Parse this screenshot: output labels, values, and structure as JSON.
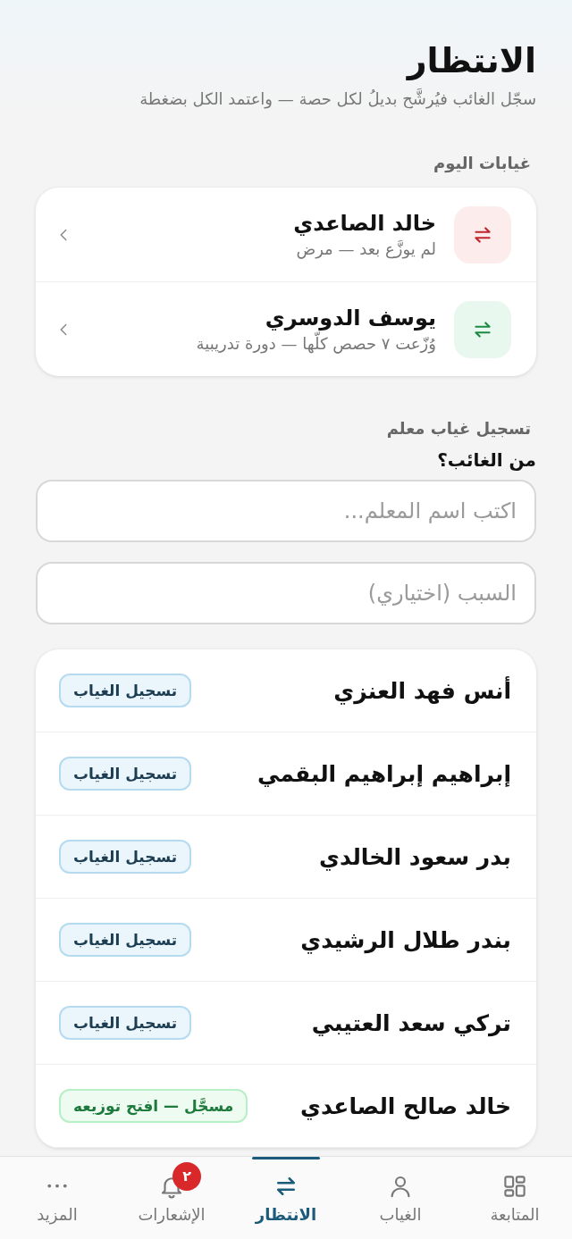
{
  "header": {
    "title": "الانتظار",
    "subtitle": "سجّل الغائب فيُرشَّح بديلُ لكل حصة — واعتمد الكل بضغطة"
  },
  "today_absences": {
    "label": "غيابات اليوم",
    "items": [
      {
        "name": "خالد الصاعدي",
        "detail": "لم يوزَّع بعد — مرض",
        "kind": "pending"
      },
      {
        "name": "يوسف الدوسري",
        "detail": "وُزّعت ٧ حصص كلّها — دورة تدريبية",
        "kind": "done"
      }
    ]
  },
  "register_absence": {
    "label": "تسجيل غياب معلم",
    "question": "من الغائب؟",
    "name_field": {
      "placeholder": "اكتب اسم المعلم..."
    },
    "reason_field": {
      "placeholder": "السبب (اختياري)"
    }
  },
  "teachers": [
    {
      "name": "أنس فهد العنزي",
      "action": "تسجيل الغياب",
      "kind": "register"
    },
    {
      "name": "إبراهيم إبراهيم البقمي",
      "action": "تسجيل الغياب",
      "kind": "register"
    },
    {
      "name": "بدر سعود الخالدي",
      "action": "تسجيل الغياب",
      "kind": "register"
    },
    {
      "name": "بندر طلال الرشيدي",
      "action": "تسجيل الغياب",
      "kind": "register"
    },
    {
      "name": "تركي سعد العتيبي",
      "action": "تسجيل الغياب",
      "kind": "register"
    },
    {
      "name": "خالد صالح الصاعدي",
      "action": "مسجَّل — افتح توزيعه",
      "kind": "registered"
    }
  ],
  "nav": [
    {
      "label": "المتابعة",
      "kind": "grid",
      "selected": false
    },
    {
      "label": "الغياب",
      "kind": "person",
      "selected": false
    },
    {
      "label": "الانتظار",
      "kind": "swap",
      "selected": true
    },
    {
      "label": "الإشعارات",
      "kind": "bell",
      "selected": false,
      "badge": "٢"
    },
    {
      "label": "المزيد",
      "kind": "dots",
      "selected": false
    }
  ]
}
